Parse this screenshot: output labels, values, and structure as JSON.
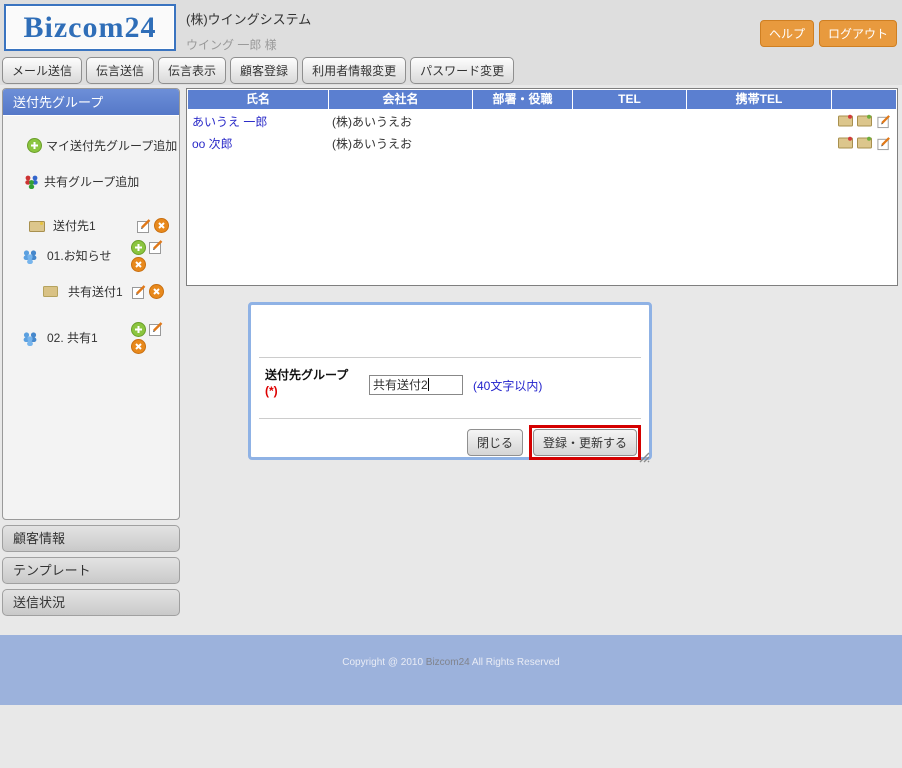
{
  "header": {
    "logo": "Bizcom24",
    "company": "(株)ウイングシステム",
    "user": "ウイング 一郎 様",
    "help_label": "ヘルプ",
    "logout_label": "ログアウト"
  },
  "toolbar": {
    "items": [
      "メール送信",
      "伝言送信",
      "伝言表示",
      "顧客登録",
      "利用者情報変更",
      "パスワード変更"
    ]
  },
  "sidebar": {
    "title": "送付先グループ",
    "add_my_group_label": "マイ送付先グループ追加",
    "add_shared_group_label": "共有グループ追加",
    "groups": [
      {
        "label": "送付先1"
      },
      {
        "label": "01.お知らせ"
      },
      {
        "label": "共有送付1"
      },
      {
        "label": "02. 共有1"
      }
    ],
    "accordion": [
      "顧客情報",
      "テンプレート",
      "送信状況"
    ]
  },
  "table": {
    "columns": [
      "氏名",
      "会社名",
      "部署・役職",
      "TEL",
      "携帯TEL"
    ],
    "rows": [
      {
        "name": "あいうえ 一郎",
        "company": "(株)あいうえお",
        "dept": "",
        "tel": "",
        "mobile": ""
      },
      {
        "name": "oo 次郎",
        "company": "(株)あいうえお",
        "dept": "",
        "tel": "",
        "mobile": ""
      }
    ]
  },
  "dialog": {
    "field_label": "送付先グループ",
    "required_mark": "(*)",
    "input_value": "共有送付2",
    "hint": "(40文字以内)",
    "close_label": "閉じる",
    "submit_label": "登録・更新する"
  },
  "footer": {
    "copyright_prefix": "Copyright @ 2010 ",
    "brand": "Bizcom24",
    "copyright_suffix": " All Rights Reserved"
  },
  "colors": {
    "accent_blue": "#5b7fd0",
    "footer_blue": "#9cb2dc",
    "button_orange": "#e89a3e",
    "highlight_red": "#d40000",
    "link_blue": "#2a2ac8"
  }
}
